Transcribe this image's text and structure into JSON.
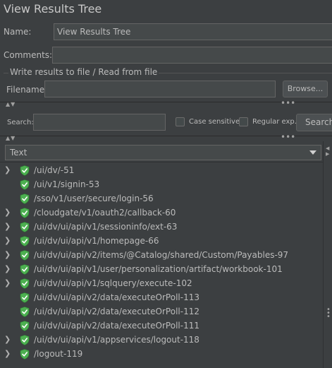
{
  "panel": {
    "title": "View Results Tree"
  },
  "name": {
    "label": "Name:",
    "value": "View Results Tree"
  },
  "comments": {
    "label": "Comments:",
    "value": ""
  },
  "file_group": {
    "title": "Write results to file / Read from file",
    "filename_label": "Filename",
    "filename_value": "",
    "browse_label": "Browse..."
  },
  "search": {
    "label": "Search:",
    "value": "",
    "case_sensitive_label": "Case sensitive",
    "regex_label": "Regular exp.",
    "button_label": "Search"
  },
  "renderer": {
    "selected": "Text"
  },
  "tree": {
    "items": [
      {
        "label": "/ui/dv/-51",
        "expandable": true,
        "status": "success"
      },
      {
        "label": "/ui/v1/signin-53",
        "expandable": false,
        "status": "success"
      },
      {
        "label": "/sso/v1/user/secure/login-56",
        "expandable": false,
        "status": "success"
      },
      {
        "label": "/cloudgate/v1/oauth2/callback-60",
        "expandable": true,
        "status": "success"
      },
      {
        "label": "/ui/dv/ui/api/v1/sessioninfo/ext-63",
        "expandable": true,
        "status": "success"
      },
      {
        "label": "/ui/dv/ui/api/v1/homepage-66",
        "expandable": true,
        "status": "success"
      },
      {
        "label": "/ui/dv/ui/api/v2/items/@Catalog/shared/Custom/Payables-97",
        "expandable": true,
        "status": "success"
      },
      {
        "label": "/ui/dv/ui/api/v1/user/personalization/artifact/workbook-101",
        "expandable": true,
        "status": "success"
      },
      {
        "label": "/ui/dv/ui/api/v1/sqlquery/execute-102",
        "expandable": true,
        "status": "success"
      },
      {
        "label": "/ui/dv/ui/api/v2/data/executeOrPoll-113",
        "expandable": false,
        "status": "success"
      },
      {
        "label": "/ui/dv/ui/api/v2/data/executeOrPoll-112",
        "expandable": false,
        "status": "success"
      },
      {
        "label": "/ui/dv/ui/api/v2/data/executeOrPoll-111",
        "expandable": false,
        "status": "success"
      },
      {
        "label": "/ui/dv/ui/api/v1/appservices/logout-118",
        "expandable": true,
        "status": "success"
      },
      {
        "label": "/logout-119",
        "expandable": true,
        "status": "success"
      }
    ]
  },
  "colors": {
    "background": "#3c3f41",
    "field_bg": "#45494a",
    "text": "#bbbbbb",
    "success_icon": "#4caf50"
  },
  "icons": {
    "expander": "chevron-right-icon",
    "status": "shield-check-icon"
  }
}
